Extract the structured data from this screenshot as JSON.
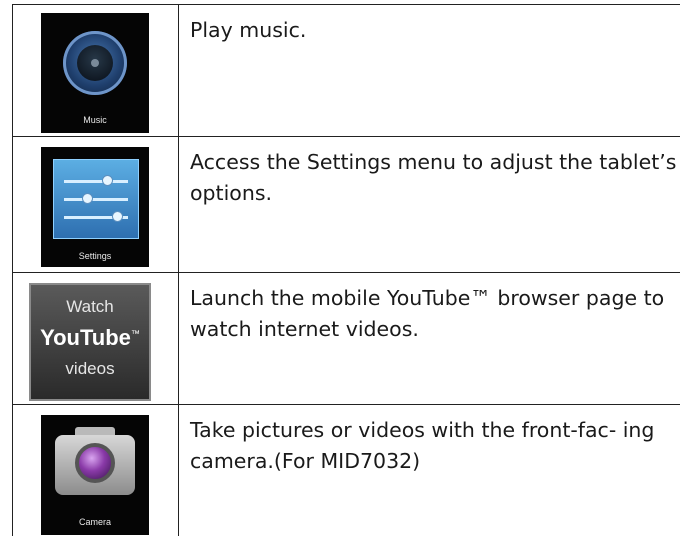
{
  "rows": [
    {
      "icon_name": "music-app-icon",
      "icon_label": "Music",
      "description": "Play music."
    },
    {
      "icon_name": "settings-app-icon",
      "icon_label": "Settings",
      "description": "Access the Settings menu to adjust the tablet’s options."
    },
    {
      "icon_name": "youtube-app-icon",
      "icon_line1": "Watch",
      "icon_line2": "YouTube",
      "icon_tm": "™",
      "icon_line3": "videos",
      "description": "Launch the mobile YouTube™ browser page to watch internet videos."
    },
    {
      "icon_name": "camera-app-icon",
      "icon_label": "Camera",
      "description": "Take pictures or videos with the front-fac- ing camera.(For MID7032)"
    }
  ]
}
